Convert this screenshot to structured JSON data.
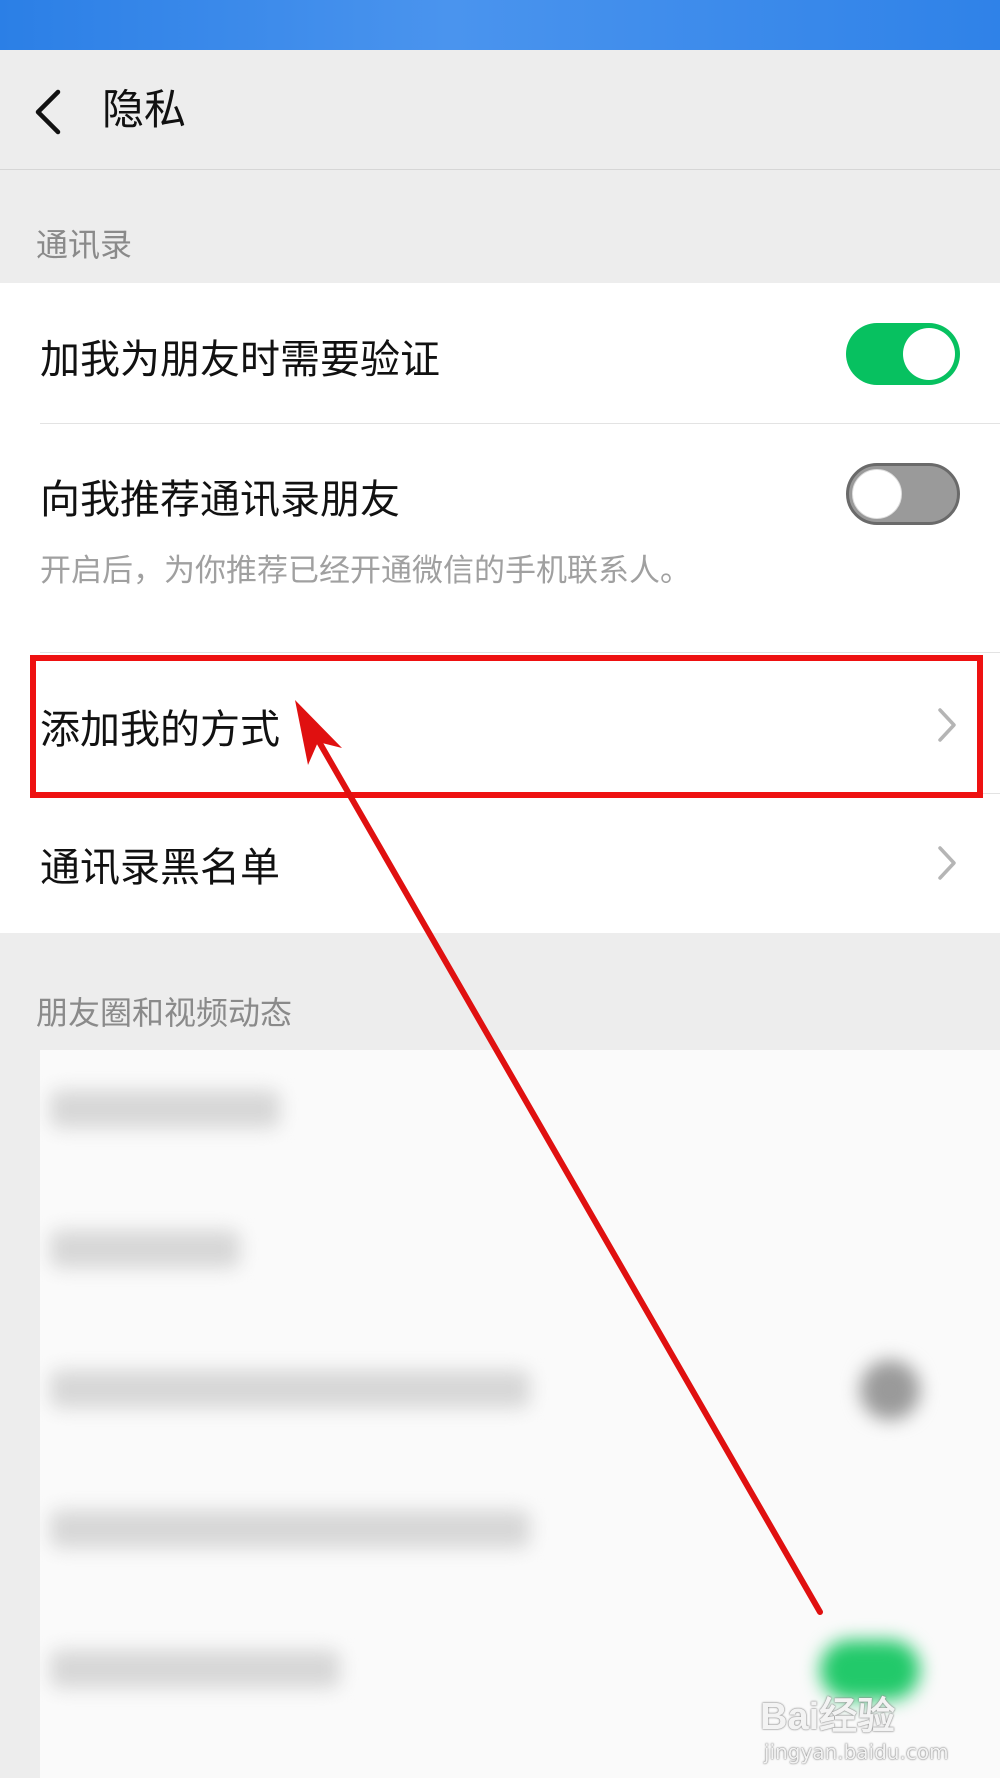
{
  "header": {
    "title": "隐私"
  },
  "sections": {
    "contacts_header": "通讯录",
    "moments_header": "朋友圈和视频动态"
  },
  "settings": {
    "verify_friend": {
      "label": "加我为朋友时需要验证",
      "enabled": true
    },
    "recommend_contacts": {
      "label": "向我推荐通讯录朋友",
      "description": "开启后，为你推荐已经开通微信的手机联系人。",
      "enabled": false
    },
    "add_methods": {
      "label": "添加我的方式"
    },
    "blacklist": {
      "label": "通讯录黑名单"
    }
  },
  "watermark": {
    "brand": "Bai经验",
    "url": "jingyan.baidu.com"
  },
  "colors": {
    "accent_green": "#07c160",
    "highlight_red": "#ee1111",
    "status_bar_blue": "#2b7fe6"
  },
  "icons": [
    "back-arrow-icon",
    "chevron-right-icon",
    "annotation-arrow"
  ]
}
